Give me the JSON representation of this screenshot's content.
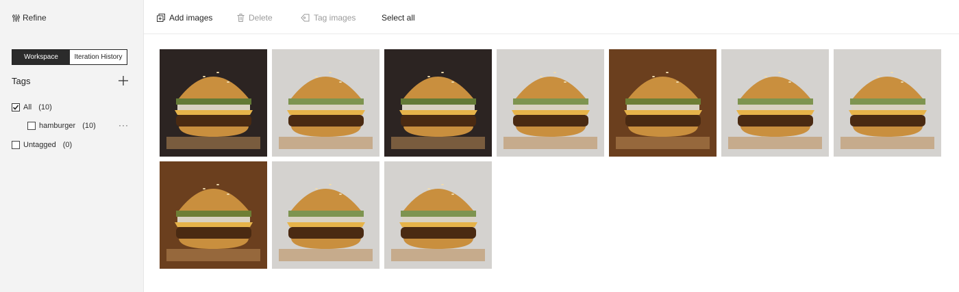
{
  "sidebar": {
    "refine_label": "Refine",
    "segments": [
      "Workspace",
      "Iteration History"
    ],
    "tags_title": "Tags",
    "tags": [
      {
        "label": "All",
        "count": "(10)",
        "checked": true
      },
      {
        "label": "hamburger",
        "count": "(10)",
        "checked": false
      },
      {
        "label": "Untagged",
        "count": "(0)",
        "checked": false
      }
    ],
    "more_label": "···"
  },
  "toolbar": {
    "add_images": "Add images",
    "delete": "Delete",
    "tag_images": "Tag images",
    "select_all": "Select all"
  },
  "gallery": {
    "images": [
      {
        "icon": "hamburger-photo",
        "bg": "dark"
      },
      {
        "icon": "hamburger-photo",
        "bg": "light"
      },
      {
        "icon": "hamburger-photo",
        "bg": "dark"
      },
      {
        "icon": "hamburger-photo",
        "bg": "light"
      },
      {
        "icon": "hamburger-photo",
        "bg": "brown"
      },
      {
        "icon": "hamburger-photo",
        "bg": "light"
      },
      {
        "icon": "hamburger-photo",
        "bg": "light"
      },
      {
        "icon": "hamburger-photo",
        "bg": "brown"
      },
      {
        "icon": "hamburger-photo",
        "bg": "light"
      },
      {
        "icon": "hamburger-photo",
        "bg": "light"
      }
    ]
  },
  "colors": {
    "sidebar_bg": "#f3f3f3",
    "segment_active": "#2b2b2b",
    "disabled_text": "#9a9a9a",
    "bun": "#c98f3e",
    "patty": "#4a2a12",
    "cheese": "#e6b34a"
  }
}
